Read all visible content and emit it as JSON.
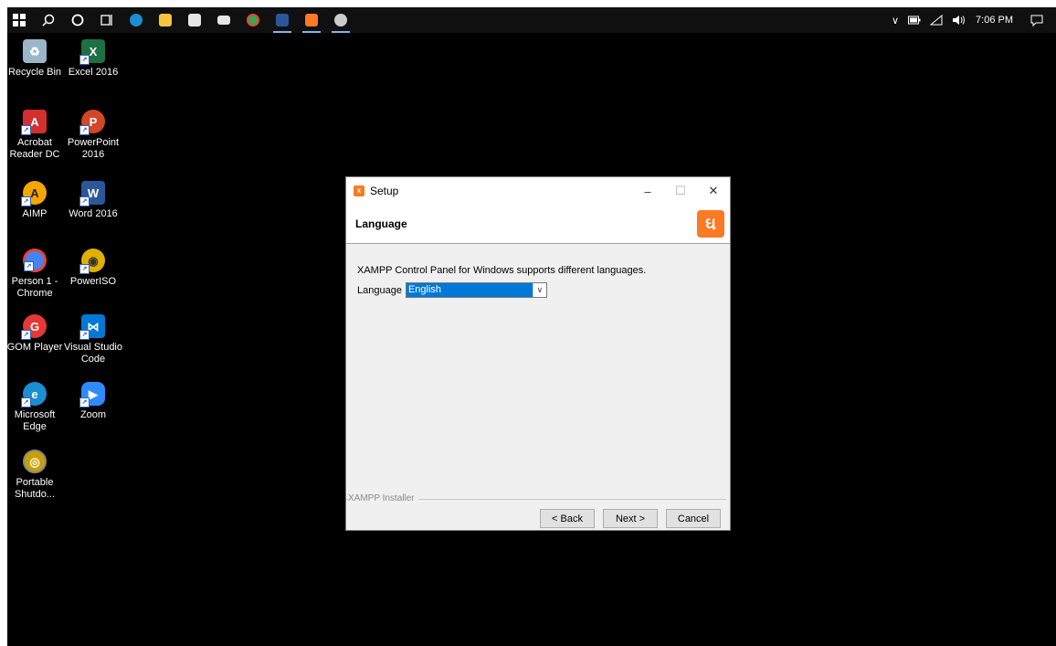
{
  "taskbar": {
    "buttons": [
      {
        "name": "start-windows-icon"
      },
      {
        "name": "search-icon"
      },
      {
        "name": "cortana-icon"
      },
      {
        "name": "task-view-icon"
      },
      {
        "name": "edge-icon",
        "color": "#1a8fd1"
      },
      {
        "name": "file-explorer-icon",
        "color": "#f5c53e"
      },
      {
        "name": "store-icon",
        "color": "#e6e6e6"
      },
      {
        "name": "mail-icon",
        "color": "#e6e6e6"
      },
      {
        "name": "chrome-icon",
        "color": "#34a853"
      },
      {
        "name": "word-icon",
        "color": "#2b579a"
      },
      {
        "name": "xampp-icon",
        "color": "#fb7a24"
      },
      {
        "name": "paint-icon",
        "color": "#cccccc"
      }
    ],
    "tray": {
      "chevron": "∨",
      "time": "7:06 PM"
    }
  },
  "desktop": {
    "icons": [
      {
        "label1": "Recycle Bin",
        "label2": "",
        "color": "#9ab6c8",
        "glyph": "♻"
      },
      {
        "label1": "Excel 2016",
        "label2": "",
        "color": "#1d7044",
        "glyph": "X"
      },
      {
        "label1": "Acrobat",
        "label2": "Reader DC",
        "color": "#d32f2f",
        "glyph": "A"
      },
      {
        "label1": "PowerPoint",
        "label2": "2016",
        "color": "#d24726",
        "glyph": "P"
      },
      {
        "label1": "AIMP",
        "label2": "",
        "color": "#f4a600",
        "glyph": "A"
      },
      {
        "label1": "Word 2016",
        "label2": "",
        "color": "#2b579a",
        "glyph": "W"
      },
      {
        "label1": "Person 1 -",
        "label2": "Chrome",
        "color": "#4285f4",
        "glyph": "●"
      },
      {
        "label1": "PowerISO",
        "label2": "",
        "color": "#e0b000",
        "glyph": "◉"
      },
      {
        "label1": "GOM Player",
        "label2": "",
        "color": "#e53935",
        "glyph": "G"
      },
      {
        "label1": "Visual Studio",
        "label2": "Code",
        "color": "#0078d4",
        "glyph": "⋈"
      },
      {
        "label1": "Microsoft",
        "label2": "Edge",
        "color": "#1a8fd1",
        "glyph": "e"
      },
      {
        "label1": "Zoom",
        "label2": "",
        "color": "#2d8cff",
        "glyph": "▶"
      },
      {
        "label1": "Portable",
        "label2": "Shutdo...",
        "color": "#c8a000",
        "glyph": "◎"
      }
    ]
  },
  "dialog": {
    "title": "Setup",
    "minimize": "–",
    "maximize": "☐",
    "close": "✕",
    "header_title": "Language",
    "description": "XAMPP Control Panel for Windows supports different languages.",
    "language_label": "Language",
    "language_value": "English",
    "group_label": "XAMPP Installer",
    "back_label": "< Back",
    "next_label": "Next >",
    "cancel_label": "Cancel"
  }
}
